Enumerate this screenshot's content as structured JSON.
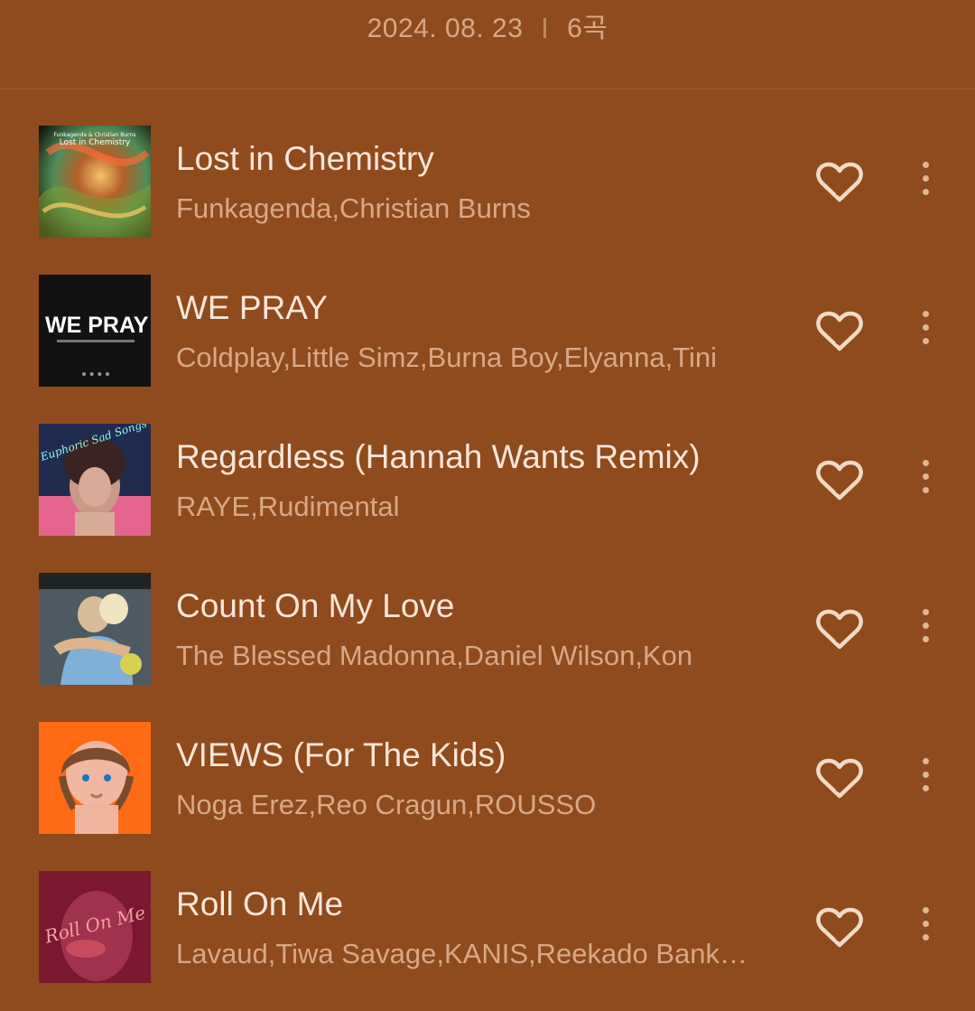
{
  "header": {
    "date": "2024. 08. 23",
    "count": "6곡"
  },
  "tracks": [
    {
      "title": "Lost in Chemistry",
      "artist": "Funkagenda,Christian Burns",
      "art": {
        "kind": "abstract",
        "top": "#0f0d05",
        "mid": "#9d5c1b",
        "accent": "#8dbf46",
        "overlay": "#ff6b3a",
        "caption": "Lost in Chemistry",
        "caption_top": "Funkagenda & Christian Burns"
      }
    },
    {
      "title": "WE PRAY",
      "artist": "Coldplay,Little Simz,Burna Boy,Elyanna,Tini",
      "art": {
        "kind": "text",
        "bg": "#121212",
        "caption": "WE PRAY"
      }
    },
    {
      "title": "Regardless (Hannah Wants Remix)",
      "artist": "RAYE,Rudimental",
      "art": {
        "kind": "portrait",
        "bg": "#1f2b4f",
        "accent": "#e5658f",
        "caption": "Euphoric Sad Songs"
      }
    },
    {
      "title": "Count On My Love",
      "artist": "The Blessed Madonna,Daniel Wilson,Kon",
      "art": {
        "kind": "photo",
        "bg": "#4e5a61",
        "accent": "#d7d14f"
      }
    },
    {
      "title": "VIEWS (For The Kids)",
      "artist": "Noga Erez,Reo Cragun,ROUSSO",
      "art": {
        "kind": "kid",
        "bg": "#ff6a14",
        "accent": "#7a4b2d"
      }
    },
    {
      "title": "Roll On Me",
      "artist": "Lavaud,Tiwa Savage,KANIS,Reekado Banks,...",
      "art": {
        "kind": "script",
        "bg": "#8f2039",
        "accent": "#c54b5d",
        "caption": "Roll On Me"
      }
    }
  ]
}
